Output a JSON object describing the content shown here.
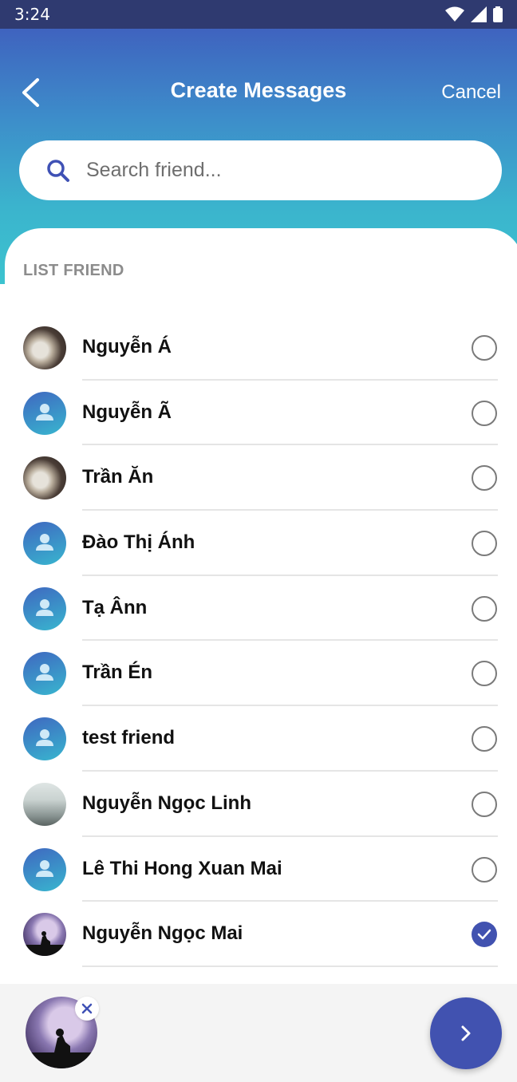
{
  "status_bar": {
    "time": "3:24"
  },
  "header": {
    "title": "Create Messages",
    "cancel_label": "Cancel"
  },
  "search": {
    "placeholder": "Search friend..."
  },
  "section_label": "LIST FRIEND",
  "friends": [
    {
      "name": "Nguyễn Á",
      "avatar": "photo-food",
      "selected": false
    },
    {
      "name": "Nguyễn Ã",
      "avatar": "default-person",
      "selected": false
    },
    {
      "name": "Trần Ăn",
      "avatar": "photo-food",
      "selected": false
    },
    {
      "name": "Đào Thị Ánh",
      "avatar": "default-person",
      "selected": false
    },
    {
      "name": "Tạ Ânn",
      "avatar": "default-person",
      "selected": false
    },
    {
      "name": "Trần Én",
      "avatar": "default-person",
      "selected": false
    },
    {
      "name": "test friend",
      "avatar": "default-person",
      "selected": false
    },
    {
      "name": "Nguyễn Ngọc Linh",
      "avatar": "photo-room",
      "selected": false
    },
    {
      "name": "Lê Thi Hong Xuan Mai",
      "avatar": "default-person",
      "selected": false
    },
    {
      "name": "Nguyễn Ngọc Mai",
      "avatar": "photo-moon",
      "selected": true
    }
  ],
  "colors": {
    "accent": "#4152b0",
    "header_top": "#3f63bf",
    "header_bottom": "#3cc3cf"
  }
}
